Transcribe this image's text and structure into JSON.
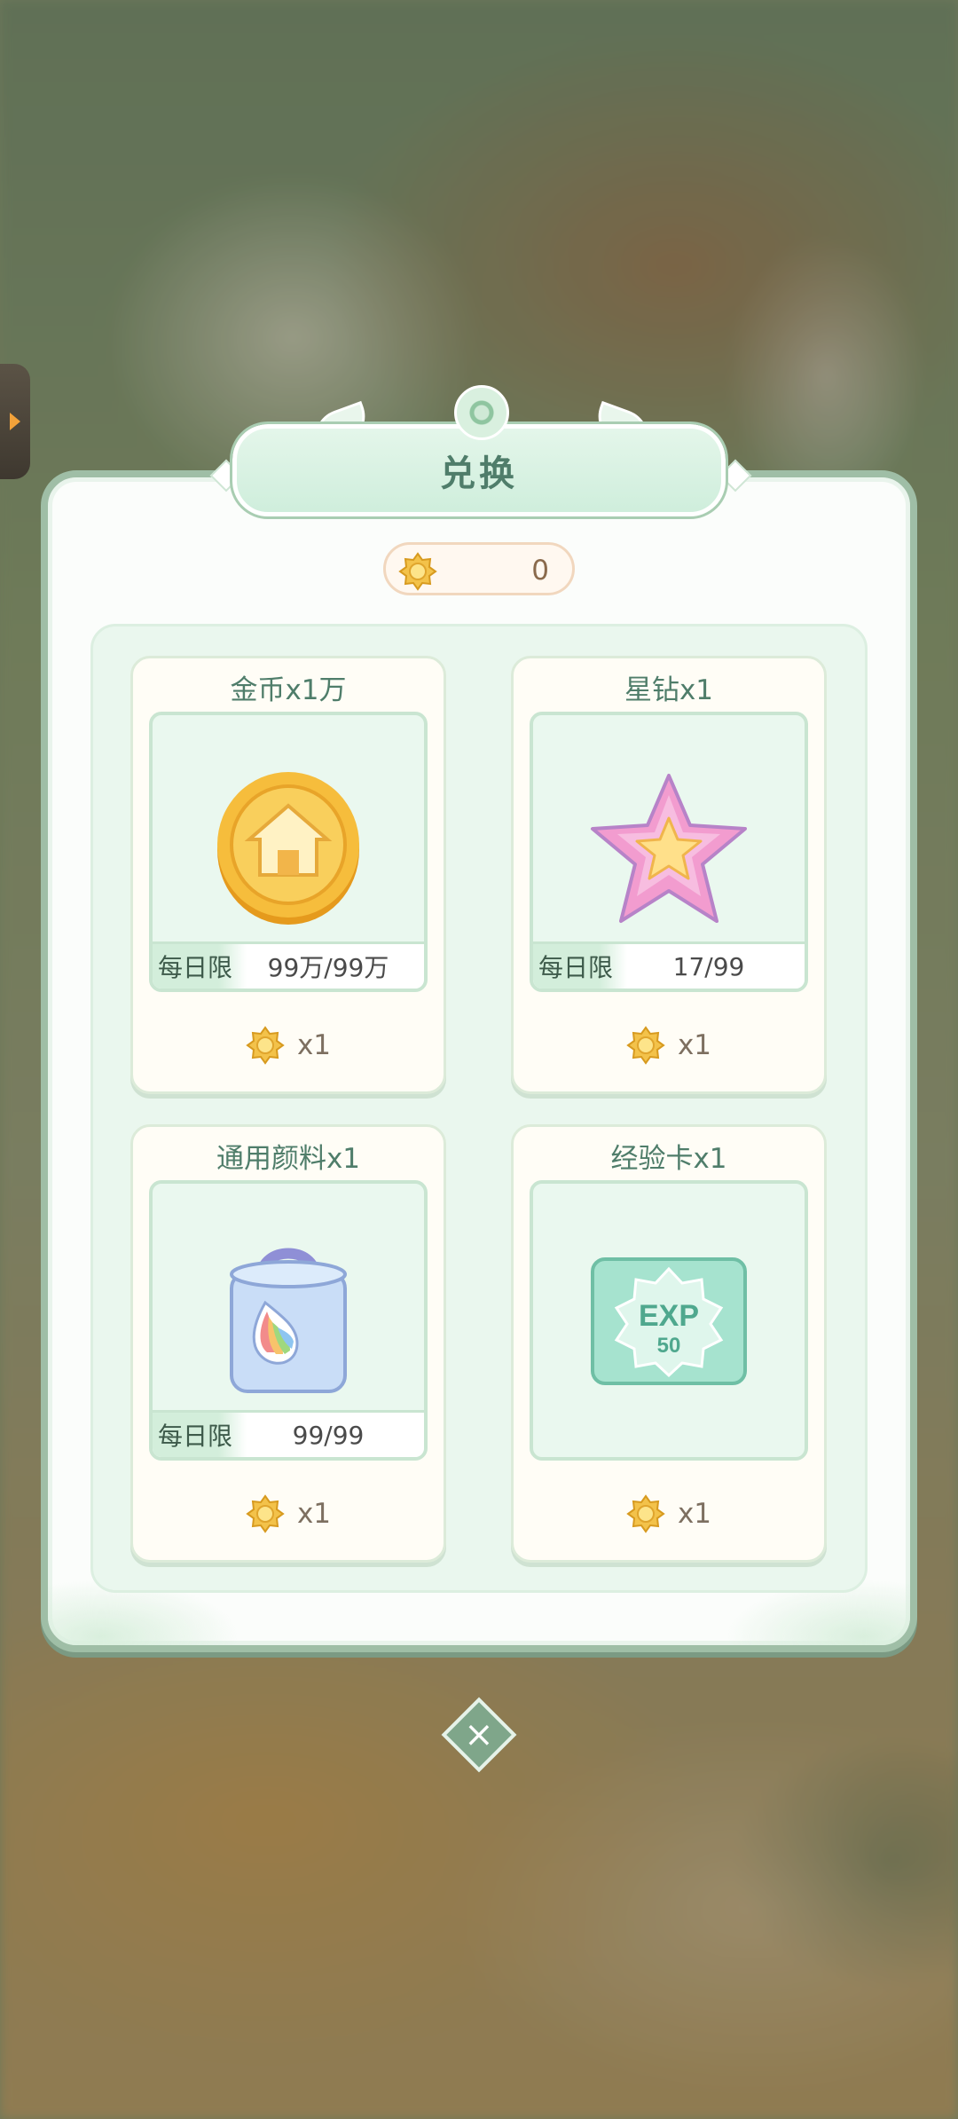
{
  "dialog": {
    "title": "兑换",
    "currency": {
      "icon": "flower-token-icon",
      "value": "0"
    }
  },
  "items": [
    {
      "title": "金币x1万",
      "icon": "gold-coin-icon",
      "limit_label": "每日限",
      "limit_value": "99万/99万",
      "cost_icon": "flower-token-icon",
      "cost_qty": "x1"
    },
    {
      "title": "星钻x1",
      "icon": "star-diamond-icon",
      "limit_label": "每日限",
      "limit_value": "17/99",
      "cost_icon": "flower-token-icon",
      "cost_qty": "x1"
    },
    {
      "title": "通用颜料x1",
      "icon": "paint-bucket-icon",
      "limit_label": "每日限",
      "limit_value": "99/99",
      "cost_icon": "flower-token-icon",
      "cost_qty": "x1"
    },
    {
      "title": "经验卡x1",
      "icon": "exp-card-icon",
      "card_text": "EXP",
      "card_number": "50",
      "cost_icon": "flower-token-icon",
      "cost_qty": "x1"
    }
  ],
  "colors": {
    "accent_green": "#4f7d6a",
    "panel_bg": "#eaf7ee",
    "card_bg": "#fffdf6",
    "coin_gold": "#f2b438",
    "star_pink": "#f29ccf"
  }
}
